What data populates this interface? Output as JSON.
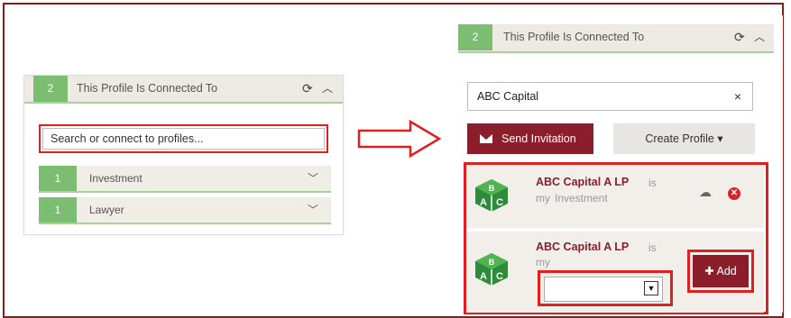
{
  "left_panel": {
    "count": "2",
    "title": "This Profile Is Connected To",
    "refresh_icon": "refresh-icon",
    "collapse_icon": "chevron-up-icon",
    "search_placeholder": "Search or connect to profiles...",
    "rows": [
      {
        "count": "1",
        "label": "Investment"
      },
      {
        "count": "1",
        "label": "Lawyer"
      }
    ]
  },
  "right_panel": {
    "count": "2",
    "title": "This Profile Is Connected To",
    "search_value": "ABC Capital",
    "clear_label": "×",
    "invite_label": "Send Invitation",
    "create_label": "Create Profile",
    "results": [
      {
        "name": "ABC Capital A LP",
        "is": "is",
        "my": "my",
        "relation": "Investment"
      },
      {
        "name": "ABC Capital A LP",
        "is": "is",
        "my": "my",
        "relation": ""
      }
    ],
    "add_label": "Add"
  },
  "colors": {
    "accent_green": "#7dbd72",
    "brand_red": "#8b1e2a",
    "highlight_red": "#e02020"
  }
}
